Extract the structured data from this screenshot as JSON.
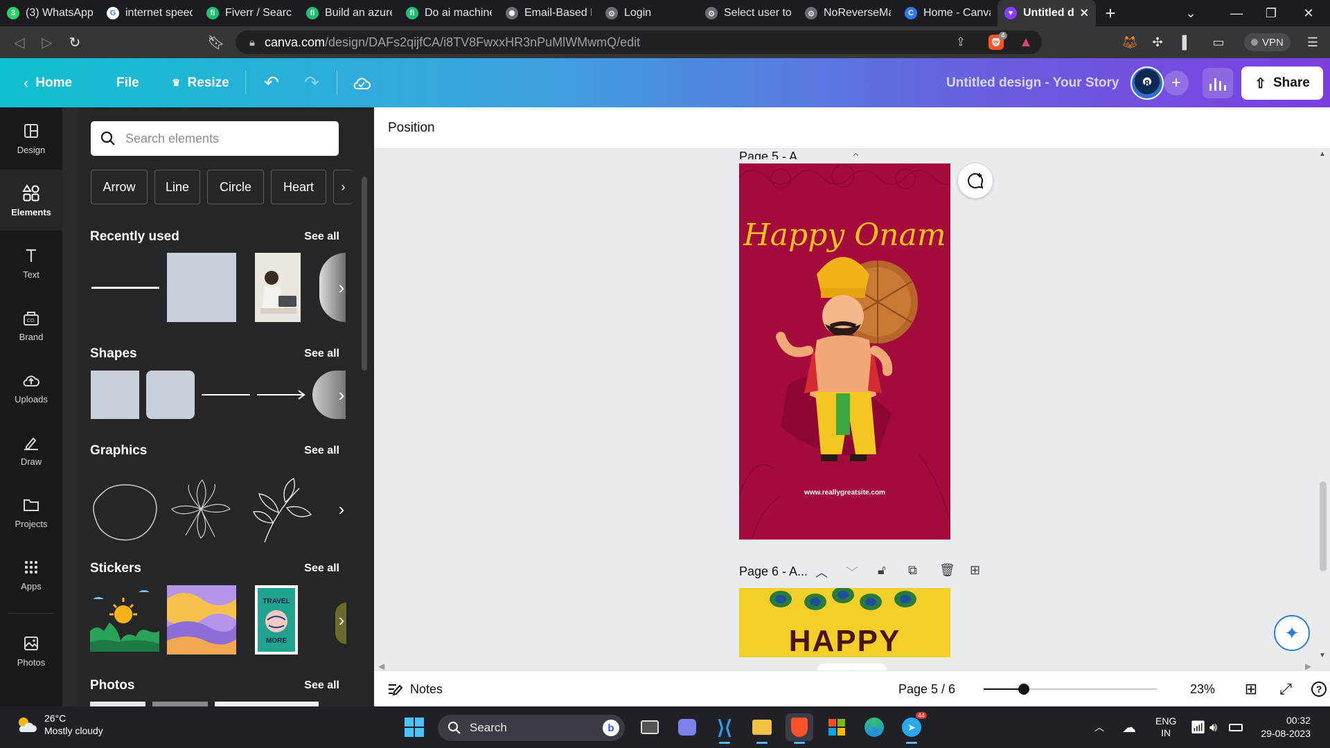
{
  "browser": {
    "tabs": [
      {
        "label": "(3) WhatsApp",
        "fav_bg": "#25d366",
        "fav": "3"
      },
      {
        "label": "internet speed",
        "fav_bg": "#ffffff",
        "fav": "G"
      },
      {
        "label": "Fiverr / Search",
        "fav_bg": "#1dbf73",
        "fav": "fi"
      },
      {
        "label": "Build an azure",
        "fav_bg": "#1dbf73",
        "fav": "fi"
      },
      {
        "label": "Do ai machine",
        "fav_bg": "#1dbf73",
        "fav": "fi"
      },
      {
        "label": "Email-Based Lo",
        "fav_bg": "#6b6e75",
        "fav": "✺"
      },
      {
        "label": "Login",
        "fav_bg": "#6b6e75",
        "fav": "⊙"
      },
      {
        "label": "Select user to",
        "fav_bg": "#6b6e75",
        "fav": "⊙"
      },
      {
        "label": "NoReverseMat",
        "fav_bg": "#6b6e75",
        "fav": "⊙"
      },
      {
        "label": "Home - Canva",
        "fav_bg": "#2d7be5",
        "fav": "C"
      },
      {
        "label": "Untitled d",
        "fav_bg": "#8b3dff",
        "fav": "♥",
        "active": true
      }
    ],
    "url_host": "canva.com",
    "url_path": "/design/DAFs2qijfCA/i8TV8FwxxHR3nPuMlWMwmQ/edit",
    "brave_badge": "4",
    "vpn_label": "VPN"
  },
  "header": {
    "home_label": "Home",
    "file_label": "File",
    "resize_label": "Resize",
    "design_title": "Untitled design - Your Story",
    "share_label": "Share",
    "gradient_start": "#0fc0d0",
    "gradient_end": "#7b3fe0"
  },
  "rail": [
    {
      "label": "Design",
      "icon": "design-icon"
    },
    {
      "label": "Elements",
      "icon": "elements-icon",
      "active": true
    },
    {
      "label": "Text",
      "icon": "text-icon"
    },
    {
      "label": "Brand",
      "icon": "brand-icon"
    },
    {
      "label": "Uploads",
      "icon": "uploads-icon"
    },
    {
      "label": "Draw",
      "icon": "draw-icon"
    },
    {
      "label": "Projects",
      "icon": "projects-icon"
    },
    {
      "label": "Apps",
      "icon": "apps-icon"
    },
    {
      "label": "Photos",
      "icon": "photos-icon"
    }
  ],
  "panel": {
    "search_placeholder": "Search elements",
    "chips": [
      "Arrow",
      "Line",
      "Circle",
      "Heart"
    ],
    "sections": {
      "recently_used": "Recently used",
      "shapes": "Shapes",
      "graphics": "Graphics",
      "stickers": "Stickers",
      "photos": "Photos"
    },
    "see_all": "See all",
    "sticker_travel_top": "TRAVEL",
    "sticker_travel_bottom": "MORE"
  },
  "workspace": {
    "toolbar_label": "Position",
    "page5_label": "Page 5 - A...",
    "page6_label": "Page 6 - A...",
    "design5": {
      "title": "Happy Onam",
      "website": "www.reallygreatsite.com",
      "bg": "#a40b3b",
      "title_color": "#f7c21c"
    },
    "design6": {
      "title": "HAPPY",
      "bg": "#f4cf2a"
    }
  },
  "footer": {
    "notes_label": "Notes",
    "page_indicator": "Page 5 / 6",
    "zoom": "23%",
    "zoom_fraction": 0.23
  },
  "taskbar": {
    "temperature": "26°C",
    "condition": "Mostly cloudy",
    "search_label": "Search",
    "lang_top": "ENG",
    "lang_bottom": "IN",
    "time": "00:32",
    "date": "29-08-2023",
    "telegram_badge": "44"
  }
}
